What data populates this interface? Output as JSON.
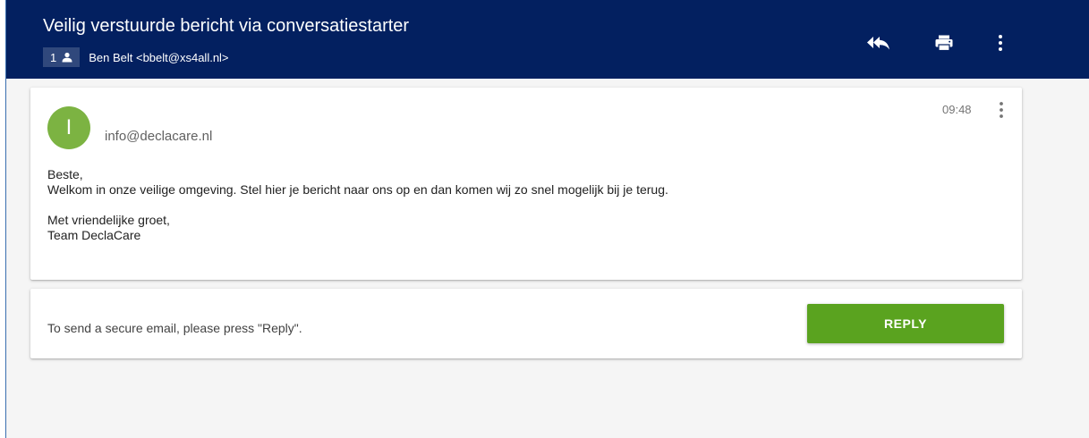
{
  "header": {
    "subject": "Veilig verstuurde bericht via conversatiestarter",
    "participant_count": "1",
    "participant_icon": "person-icon",
    "participants": "Ben Belt <bbelt@xs4all.nl>",
    "actions": [
      {
        "name": "reply-all",
        "icon": "reply-all-icon"
      },
      {
        "name": "print",
        "icon": "print-icon"
      },
      {
        "name": "more",
        "icon": "more-vertical-icon"
      }
    ],
    "background_color": "#032060"
  },
  "message": {
    "avatar_initial": "I",
    "avatar_color": "#7cb342",
    "from": "info@declacare.nl",
    "time": "09:48",
    "body": {
      "greeting": "Beste,",
      "line1": "Welkom in onze veilige omgeving. Stel hier je bericht naar ons op en dan komen wij zo snel mogelijk bij je terug.",
      "closing": "Met vriendelijke groet,",
      "signature": "Team DeclaCare"
    }
  },
  "reply_panel": {
    "hint": "To send a secure email, please press \"Reply\".",
    "button_label": "REPLY",
    "button_color": "#5aa31f"
  }
}
